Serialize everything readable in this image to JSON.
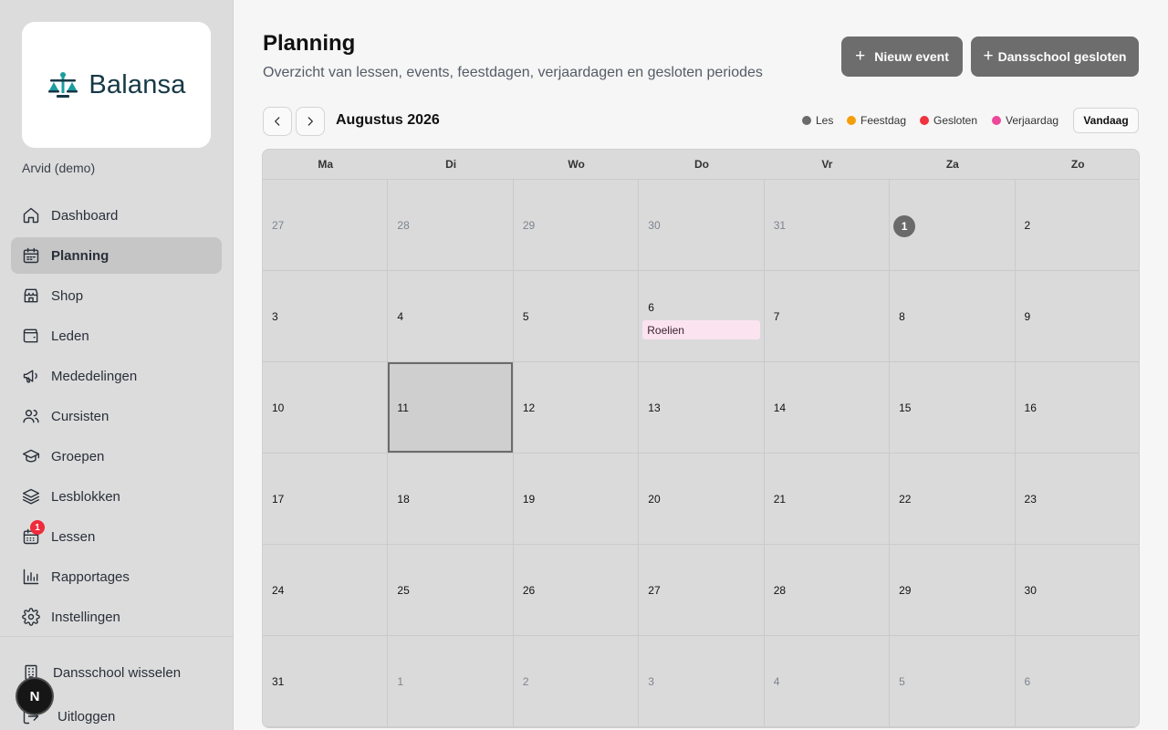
{
  "brand": {
    "name": "Balansa",
    "color": "#163845",
    "accent": "#1a9ea0"
  },
  "user": {
    "name": "Arvid (demo)"
  },
  "sidebar": {
    "items": [
      {
        "label": "Dashboard",
        "icon": "home-icon"
      },
      {
        "label": "Planning",
        "icon": "calendar-icon",
        "active": true
      },
      {
        "label": "Shop",
        "icon": "store-icon"
      },
      {
        "label": "Leden",
        "icon": "wallet-icon"
      },
      {
        "label": "Mededelingen",
        "icon": "megaphone-icon"
      },
      {
        "label": "Cursisten",
        "icon": "users-icon"
      },
      {
        "label": "Groepen",
        "icon": "graduation-cap-icon"
      },
      {
        "label": "Lesblokken",
        "icon": "layers-icon"
      },
      {
        "label": "Lessen",
        "icon": "calendar-days-icon",
        "badge": "1"
      },
      {
        "label": "Rapportages",
        "icon": "bar-chart-icon"
      },
      {
        "label": "Instellingen",
        "icon": "gear-icon"
      }
    ],
    "switch_label": "Dansschool wisselen",
    "logout_label": "Uitloggen",
    "floating_badge": "N"
  },
  "header": {
    "title": "Planning",
    "subtitle": "Overzicht van lessen, events, feestdagen, verjaardagen en gesloten periodes",
    "new_event_label": "Nieuw event",
    "closed_label": "Dansschool gesloten"
  },
  "toolbar": {
    "month": "Augustus 2026",
    "today_label": "Vandaag",
    "legend": [
      {
        "label": "Les",
        "color": "#6b6b6b"
      },
      {
        "label": "Feestdag",
        "color": "#f59e0b"
      },
      {
        "label": "Gesloten",
        "color": "#ef3340"
      },
      {
        "label": "Verjaardag",
        "color": "#ec4899"
      }
    ]
  },
  "calendar": {
    "weekdays": [
      "Ma",
      "Di",
      "Wo",
      "Do",
      "Vr",
      "Za",
      "Zo"
    ],
    "days": [
      {
        "n": "27",
        "other": true
      },
      {
        "n": "28",
        "other": true
      },
      {
        "n": "29",
        "other": true
      },
      {
        "n": "30",
        "other": true
      },
      {
        "n": "31",
        "other": true
      },
      {
        "n": "1",
        "today": true
      },
      {
        "n": "2"
      },
      {
        "n": "3"
      },
      {
        "n": "4"
      },
      {
        "n": "5"
      },
      {
        "n": "6",
        "event": "Roelien"
      },
      {
        "n": "7"
      },
      {
        "n": "8"
      },
      {
        "n": "9"
      },
      {
        "n": "10"
      },
      {
        "n": "11",
        "selected": true
      },
      {
        "n": "12"
      },
      {
        "n": "13"
      },
      {
        "n": "14"
      },
      {
        "n": "15"
      },
      {
        "n": "16"
      },
      {
        "n": "17"
      },
      {
        "n": "18"
      },
      {
        "n": "19"
      },
      {
        "n": "20"
      },
      {
        "n": "21"
      },
      {
        "n": "22"
      },
      {
        "n": "23"
      },
      {
        "n": "24"
      },
      {
        "n": "25"
      },
      {
        "n": "26"
      },
      {
        "n": "27"
      },
      {
        "n": "28"
      },
      {
        "n": "29"
      },
      {
        "n": "30"
      },
      {
        "n": "31"
      },
      {
        "n": "1",
        "other": true
      },
      {
        "n": "2",
        "other": true
      },
      {
        "n": "3",
        "other": true
      },
      {
        "n": "4",
        "other": true
      },
      {
        "n": "5",
        "other": true
      },
      {
        "n": "6",
        "other": true
      }
    ]
  }
}
